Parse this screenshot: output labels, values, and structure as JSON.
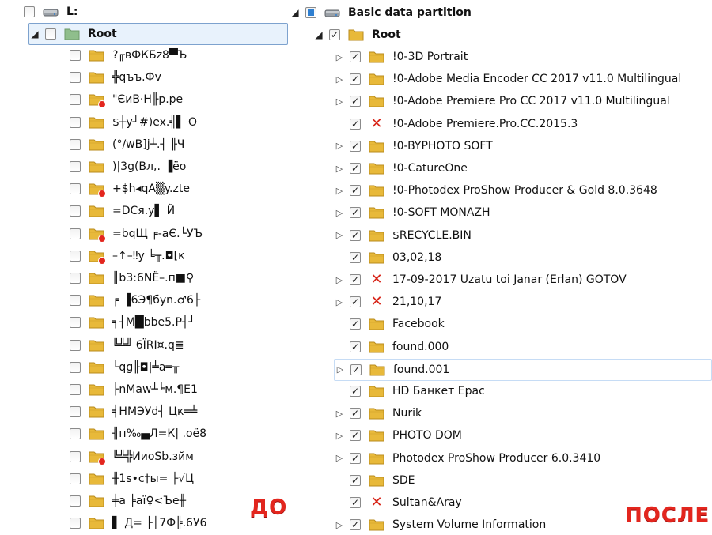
{
  "left": {
    "drive_label": "L:",
    "root_label": "Root",
    "items": [
      {
        "label": "?╓вФКБz8▀Ъ",
        "damaged": false
      },
      {
        "label": "╬qъъ.Фv",
        "damaged": false
      },
      {
        "label": "\"ЄиВ·Н╟р.ре",
        "damaged": true
      },
      {
        "label": "$┼у┘#)ex.╣▌ О",
        "damaged": false
      },
      {
        "label": "(°/wB]j┴.┤ ╟Ч",
        "damaged": false
      },
      {
        "label": ")|3g(Вл,. ▐ёо",
        "damaged": false
      },
      {
        "label": "+$h◂qА▒y.zte",
        "damaged": true
      },
      {
        "label": "=DCя.у▌ Й",
        "damaged": false
      },
      {
        "label": "=bqЩ ╒-аЄ.└УЪ",
        "damaged": true
      },
      {
        "label": "–↑–‼у ╘╥.◘[к",
        "damaged": true
      },
      {
        "label": "║b3:6NЁ–.п■♀",
        "damaged": false
      },
      {
        "label": "╒ ▐6Э¶бyn.♂6├",
        "damaged": false
      },
      {
        "label": "╕┤М█bbe5.Р┤┘",
        "damaged": false
      },
      {
        "label": "╚╩╝ 6ÏRI¤.q≣",
        "damaged": false
      },
      {
        "label": "└qg╟◘|╧а═╥",
        "damaged": false
      },
      {
        "label": "├nMaw┴╘м.¶E1",
        "damaged": false
      },
      {
        "label": "╡НМЭУd┤ Цк═╧",
        "damaged": false
      },
      {
        "label": "╢п‰▄Л=К| .оё8",
        "damaged": false
      },
      {
        "label": "╚╩╬ИиоSb.зйм",
        "damaged": true
      },
      {
        "label": "╫1s•с†ы= ├√Ц",
        "damaged": false
      },
      {
        "label": "╪а ╞аї♀<Ъе╫",
        "damaged": false
      },
      {
        "label": "▌ Д= ├│7Ф╠.6У6",
        "damaged": false
      }
    ],
    "tag": "ДО"
  },
  "right": {
    "partition_label": "Basic data partition",
    "root_label": "Root",
    "items": [
      {
        "label": "!0-3D Portrait",
        "expandable": true,
        "status": "folder"
      },
      {
        "label": "!0-Adobe Media Encoder CC 2017 v11.0 Multilingual",
        "expandable": true,
        "status": "folder"
      },
      {
        "label": "!0-Adobe Premiere Pro CC 2017 v11.0 Multilingual",
        "expandable": true,
        "status": "folder"
      },
      {
        "label": "!0-Adobe Premiere.Pro.CC.2015.3",
        "expandable": false,
        "status": "error"
      },
      {
        "label": "!0-BYPHOTO SOFT",
        "expandable": true,
        "status": "folder"
      },
      {
        "label": "!0-CatureOne",
        "expandable": true,
        "status": "folder"
      },
      {
        "label": "!0-Photodex ProShow Producer & Gold  8.0.3648",
        "expandable": true,
        "status": "folder"
      },
      {
        "label": "!0-SOFT  MONAZH",
        "expandable": true,
        "status": "folder"
      },
      {
        "label": "$RECYCLE.BIN",
        "expandable": true,
        "status": "folder"
      },
      {
        "label": "03,02,18",
        "expandable": false,
        "status": "folder"
      },
      {
        "label": "17-09-2017 Uzatu toi Janar (Erlan) GOTOV",
        "expandable": true,
        "status": "error"
      },
      {
        "label": "21,10,17",
        "expandable": true,
        "status": "error"
      },
      {
        "label": "Facebook",
        "expandable": false,
        "status": "folder"
      },
      {
        "label": "found.000",
        "expandable": false,
        "status": "folder"
      },
      {
        "label": "found.001",
        "expandable": true,
        "status": "folder"
      },
      {
        "label": "HD Банкет Ерас",
        "expandable": false,
        "status": "folder"
      },
      {
        "label": "Nurik",
        "expandable": true,
        "status": "folder"
      },
      {
        "label": "PHOTO DOM",
        "expandable": true,
        "status": "folder"
      },
      {
        "label": "Photodex ProShow Producer 6.0.3410",
        "expandable": true,
        "status": "folder"
      },
      {
        "label": "SDE",
        "expandable": false,
        "status": "folder"
      },
      {
        "label": "Sultan&Aray",
        "expandable": false,
        "status": "error"
      },
      {
        "label": "System Volume Information",
        "expandable": true,
        "status": "folder"
      }
    ],
    "tag": "ПОСЛЕ"
  },
  "colors": {
    "folder": "#e8b93a",
    "selection": "#e8f2fc",
    "accent": "#2f7fd0",
    "error": "#d8261a",
    "tag": "#e3261e"
  },
  "icons": {
    "folder": "folder-icon",
    "drive": "drive-icon",
    "error": "error-x-icon",
    "expand": "expand-arrow-icon",
    "collapse": "collapse-arrow-icon"
  }
}
